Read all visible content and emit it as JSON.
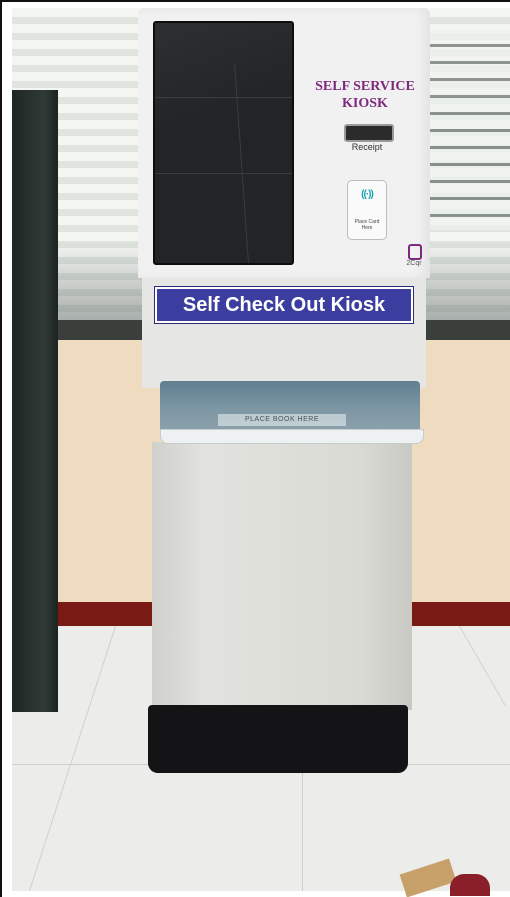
{
  "kiosk": {
    "title_line1": "SELF SERVICE",
    "title_line2": "KIOSK",
    "receipt_label": "Receipt",
    "card_reader_label_line1": "Place Card",
    "card_reader_label_line2": "Here",
    "brand_label": "2Cqr",
    "banner_text": "Self Check Out Kiosk",
    "tray_label": "PLACE BOOK HERE"
  },
  "colors": {
    "title_purple": "#7b2a7d",
    "banner_blue": "#3b3e9e",
    "nfc_teal": "#1aa3b8"
  },
  "icons": {
    "nfc": "contactless-icon",
    "brand": "brand-logo-icon"
  }
}
